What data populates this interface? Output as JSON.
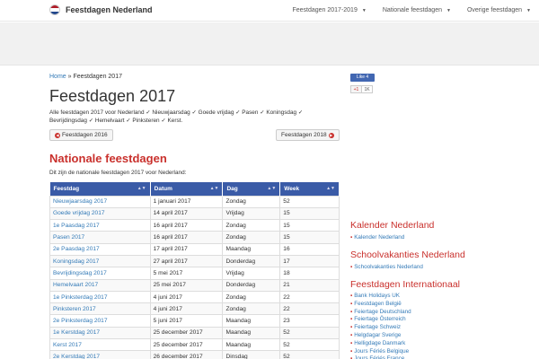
{
  "nav": {
    "brand": "Feestdagen Nederland",
    "items": [
      {
        "label": "Feestdagen 2017-2019"
      },
      {
        "label": "Nationale feestdagen"
      },
      {
        "label": "Overige feestdagen"
      }
    ]
  },
  "breadcrumb": {
    "home": "Home",
    "separator": "»",
    "current": "Feestdagen 2017"
  },
  "page": {
    "title": "Feestdagen 2017",
    "intro": "Alle feestdagen 2017 voor Nederland ✓ Nieuwjaarsdag ✓ Goede vrijdag ✓ Pasen ✓ Koningsdag ✓ Bevrijdingsdag ✓ Hemelvaart ✓ Pinksteren ✓ Kerst.",
    "prev_button": "Feestdagen 2016",
    "next_button": "Feestdagen 2018",
    "section_title": "Nationale feestdagen",
    "section_sub": "Dit zijn de nationale feestdagen 2017 voor Nederland:"
  },
  "table": {
    "headers": [
      "Feestdag",
      "Datum",
      "Dag",
      "Week"
    ],
    "rows": [
      [
        "Nieuwjaarsdag 2017",
        "1 januari 2017",
        "Zondag",
        "52"
      ],
      [
        "Goede vrijdag 2017",
        "14 april 2017",
        "Vrijdag",
        "15"
      ],
      [
        "1e Paasdag 2017",
        "16 april 2017",
        "Zondag",
        "15"
      ],
      [
        "Pasen 2017",
        "16 april 2017",
        "Zondag",
        "15"
      ],
      [
        "2e Paasdag 2017",
        "17 april 2017",
        "Maandag",
        "16"
      ],
      [
        "Koningsdag 2017",
        "27 april 2017",
        "Donderdag",
        "17"
      ],
      [
        "Bevrijdingsdag 2017",
        "5 mei 2017",
        "Vrijdag",
        "18"
      ],
      [
        "Hemelvaart 2017",
        "25 mei 2017",
        "Donderdag",
        "21"
      ],
      [
        "1e Pinksterdag 2017",
        "4 juni 2017",
        "Zondag",
        "22"
      ],
      [
        "Pinksteren 2017",
        "4 juni 2017",
        "Zondag",
        "22"
      ],
      [
        "2e Pinksterdag 2017",
        "5 juni 2017",
        "Maandag",
        "23"
      ],
      [
        "1e Kerstdag 2017",
        "25 december 2017",
        "Maandag",
        "52"
      ],
      [
        "Kerst 2017",
        "25 december 2017",
        "Maandag",
        "52"
      ],
      [
        "2e Kerstdag 2017",
        "26 december 2017",
        "Dinsdag",
        "52"
      ]
    ]
  },
  "sidebar": {
    "fb_like": "Like 4",
    "gplus": "+1",
    "gplus_count": "1K",
    "kalender_title": "Kalender Nederland",
    "kalender_items": [
      "Kalender Nederland"
    ],
    "school_title": "Schoolvakanties Nederland",
    "school_items": [
      "Schoolvakanties Nederland"
    ],
    "intl_title": "Feestdagen Internationaal",
    "intl_items": [
      "Bank Holidays UK",
      "Feestdagen België",
      "Feiertage Deutschland",
      "Feiertage Österreich",
      "Feiertage Schweiz",
      "Helgdagar Sverige",
      "Helligdage Danmark",
      "Jours Fériés Belgique",
      "Jours Fériés France"
    ]
  },
  "colors": {
    "accent": "#c9302c",
    "table_header": "#3a5ba7",
    "link": "#337ab7"
  }
}
